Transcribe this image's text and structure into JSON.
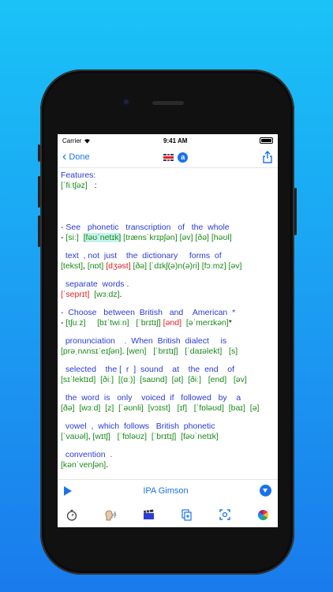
{
  "status": {
    "carrier": "Carrier",
    "time": "9:41 AM"
  },
  "nav": {
    "back_label": "Done",
    "badge_letter": "a"
  },
  "text_lines": [
    {
      "segments": [
        {
          "t": "Features:",
          "c": "en"
        }
      ]
    },
    {
      "segments": [
        {
          "t": "[ˈfiːtʃəz]",
          "c": "ipa"
        },
        {
          "t": "   :",
          "c": "black"
        }
      ]
    },
    {
      "gap": "big"
    },
    {
      "segments": [
        {
          "t": "- See   phonetic   transcription   of   the  whole",
          "c": "en"
        }
      ]
    },
    {
      "segments": [
        {
          "t": "- ",
          "c": "black"
        },
        {
          "t": "[siː]",
          "c": "ipa"
        },
        {
          "t": "  ",
          "c": "black"
        },
        {
          "t": "[fəʊˈnetɪk]",
          "c": "ipa-hl"
        },
        {
          "t": " [trænsˈkrɪpʃən] [əv] [ðə] [həʊl]",
          "c": "ipa"
        }
      ]
    },
    {
      "gap": "small"
    },
    {
      "segments": [
        {
          "t": "  text  , not  just    the  dictionary     forms  of",
          "c": "en"
        }
      ]
    },
    {
      "segments": [
        {
          "t": "[tekst]",
          "c": "ipa"
        },
        {
          "t": ", ",
          "c": "black"
        },
        {
          "t": "[nɒt]",
          "c": "ipa"
        },
        {
          "t": " ",
          "c": "black"
        },
        {
          "t": "[dʒəst]",
          "c": "ipa-red"
        },
        {
          "t": " [ðə] [ˈdɪkʃ(ə)n(ə)ri] [fɔːmz] [əv]",
          "c": "ipa"
        }
      ]
    },
    {
      "gap": "small"
    },
    {
      "segments": [
        {
          "t": "  separate  words .",
          "c": "en"
        }
      ]
    },
    {
      "segments": [
        {
          "t": "[ˈseprɪt]",
          "c": "ipa-red"
        },
        {
          "t": "  [wɜːdz]",
          "c": "ipa"
        },
        {
          "t": ".",
          "c": "black"
        }
      ]
    },
    {
      "gap": "small"
    },
    {
      "segments": [
        {
          "t": "-  Choose   between  British   and    American  *",
          "c": "en"
        }
      ]
    },
    {
      "segments": [
        {
          "t": "- ",
          "c": "black"
        },
        {
          "t": "[tʃuːz]",
          "c": "ipa"
        },
        {
          "t": "     [bɪˈtwiːn]   [ˈbrɪtɪʃ] ",
          "c": "ipa"
        },
        {
          "t": "[ənd]",
          "c": "ipa-red"
        },
        {
          "t": "  [əˈmerɪkən]",
          "c": "ipa"
        },
        {
          "t": "*",
          "c": "black"
        }
      ]
    },
    {
      "gap": "small"
    },
    {
      "segments": [
        {
          "t": "  pronunciation    .  When  British  dialect     is",
          "c": "en"
        }
      ]
    },
    {
      "segments": [
        {
          "t": "[prəˌnʌnsɪˈeɪʃən]",
          "c": "ipa"
        },
        {
          "t": ". ",
          "c": "black"
        },
        {
          "t": "[wen]   [ˈbrɪtɪʃ]   [ˈdaɪəlekt]   [s]",
          "c": "ipa"
        }
      ]
    },
    {
      "gap": "small"
    },
    {
      "segments": [
        {
          "t": "  selected    the [  r  ]  sound    at    the  end    of",
          "c": "en"
        }
      ]
    },
    {
      "segments": [
        {
          "t": "[sɪˈlektɪd]  [ðiː]  [(ɑː)]  [saʊnd]  [ət]  [ðiː]   [end]   [əv]",
          "c": "ipa"
        }
      ]
    },
    {
      "gap": "small"
    },
    {
      "segments": [
        {
          "t": "  the  word  is   only    voiced  if   followed   by    a",
          "c": "en"
        }
      ]
    },
    {
      "segments": [
        {
          "t": "[ðə]  [wɜːd]  [z]  [ˈəʊnli]  [vɔɪst]   [ɪf]   [ˈfɒləʊd]  [baɪ]  [ə]",
          "c": "ipa"
        }
      ]
    },
    {
      "gap": "small"
    },
    {
      "segments": [
        {
          "t": "  vowel  ,  which  follows   British  phonetic",
          "c": "en"
        }
      ]
    },
    {
      "segments": [
        {
          "t": "[ˈvaʊəl]",
          "c": "ipa"
        },
        {
          "t": ", ",
          "c": "black"
        },
        {
          "t": "[wɪtʃ]   [ˈfɒləʊz]  [ˈbrɪtɪʃ]  [fəʊˈnetɪk]",
          "c": "ipa"
        }
      ]
    },
    {
      "gap": "small"
    },
    {
      "segments": [
        {
          "t": "  convention  .",
          "c": "en"
        }
      ]
    },
    {
      "segments": [
        {
          "t": "[kənˈvenʃən]",
          "c": "ipa"
        },
        {
          "t": ".",
          "c": "black"
        }
      ]
    }
  ],
  "toolbar": {
    "title": "IPA Gimson"
  },
  "icons": [
    "stopwatch-icon",
    "speaker-head-icon",
    "clapperboard-icon",
    "copy-add-icon",
    "fullscreen-icon",
    "color-wheel-icon"
  ],
  "colors": {
    "accent": "#1a73e8",
    "english": "#2a3bd6",
    "ipa": "#1a8a1a",
    "ipa_red": "#e02020",
    "highlight": "#c7f3f0"
  }
}
